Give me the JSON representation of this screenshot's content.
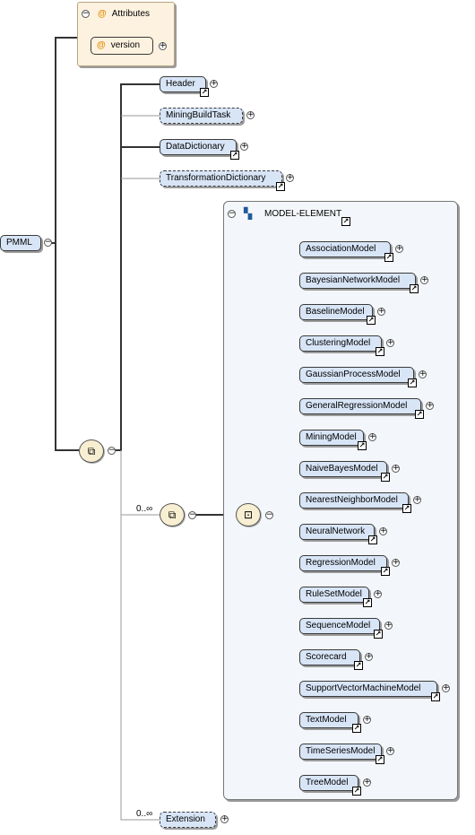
{
  "root": {
    "label": "PMML"
  },
  "attributes": {
    "title": "Attributes",
    "items": [
      {
        "label": "version"
      }
    ]
  },
  "children": [
    {
      "label": "Header"
    },
    {
      "label": "MiningBuildTask"
    },
    {
      "label": "DataDictionary"
    },
    {
      "label": "TransformationDictionary"
    }
  ],
  "model_group": {
    "title": "MODEL-ELEMENT",
    "cardinality": "0..∞"
  },
  "models": [
    {
      "label": "AssociationModel"
    },
    {
      "label": "BayesianNetworkModel"
    },
    {
      "label": "BaselineModel"
    },
    {
      "label": "ClusteringModel"
    },
    {
      "label": "GaussianProcessModel"
    },
    {
      "label": "GeneralRegressionModel"
    },
    {
      "label": "MiningModel"
    },
    {
      "label": "NaiveBayesModel"
    },
    {
      "label": "NearestNeighborModel"
    },
    {
      "label": "NeuralNetwork"
    },
    {
      "label": "RegressionModel"
    },
    {
      "label": "RuleSetModel"
    },
    {
      "label": "SequenceModel"
    },
    {
      "label": "Scorecard"
    },
    {
      "label": "SupportVectorMachineModel"
    },
    {
      "label": "TextModel"
    },
    {
      "label": "TimeSeriesModel"
    },
    {
      "label": "TreeModel"
    }
  ],
  "extension": {
    "label": "Extension",
    "cardinality": "0..∞"
  },
  "icons": {
    "expand": "+",
    "collapse": "−",
    "link": "↗",
    "sequence": "⧉",
    "choice": "⊡"
  }
}
